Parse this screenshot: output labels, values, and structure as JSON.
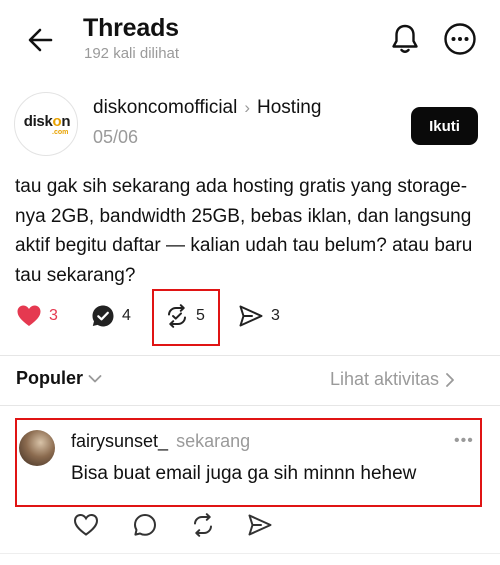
{
  "header": {
    "title": "Threads",
    "subtitle": "192 kali dilihat",
    "icons": {
      "back": "arrow-left-icon",
      "notifications": "bell-icon",
      "more": "more-circle-icon"
    }
  },
  "post": {
    "brand_logo_text": "disk",
    "brand_logo_o": "o",
    "brand_logo_end": "n",
    "brand_logo_suffix": ".com",
    "author": "diskoncomofficial",
    "topic": "Hosting",
    "date": "05/06",
    "follow_label": "Ikuti",
    "body": "tau gak sih sekarang ada hosting gratis yang storage-nya 2GB, bandwidth 25GB, bebas iklan, dan langsung aktif begitu daftar — kalian udah tau belum? atau baru tau sekarang?",
    "actions": {
      "likes": "3",
      "replies": "4",
      "reposts": "5",
      "shares": "3"
    }
  },
  "filter": {
    "label": "Populer",
    "activity_link": "Lihat aktivitas"
  },
  "reply": {
    "username": "fairysunset_",
    "time": "sekarang",
    "text": "Bisa buat email juga ga sih minnn hehew",
    "more": "•••"
  },
  "colors": {
    "like_red": "#e53950",
    "highlight_red": "#e01414",
    "muted_gray": "#9a9a9a",
    "follow_bg": "#0a0a0a"
  }
}
